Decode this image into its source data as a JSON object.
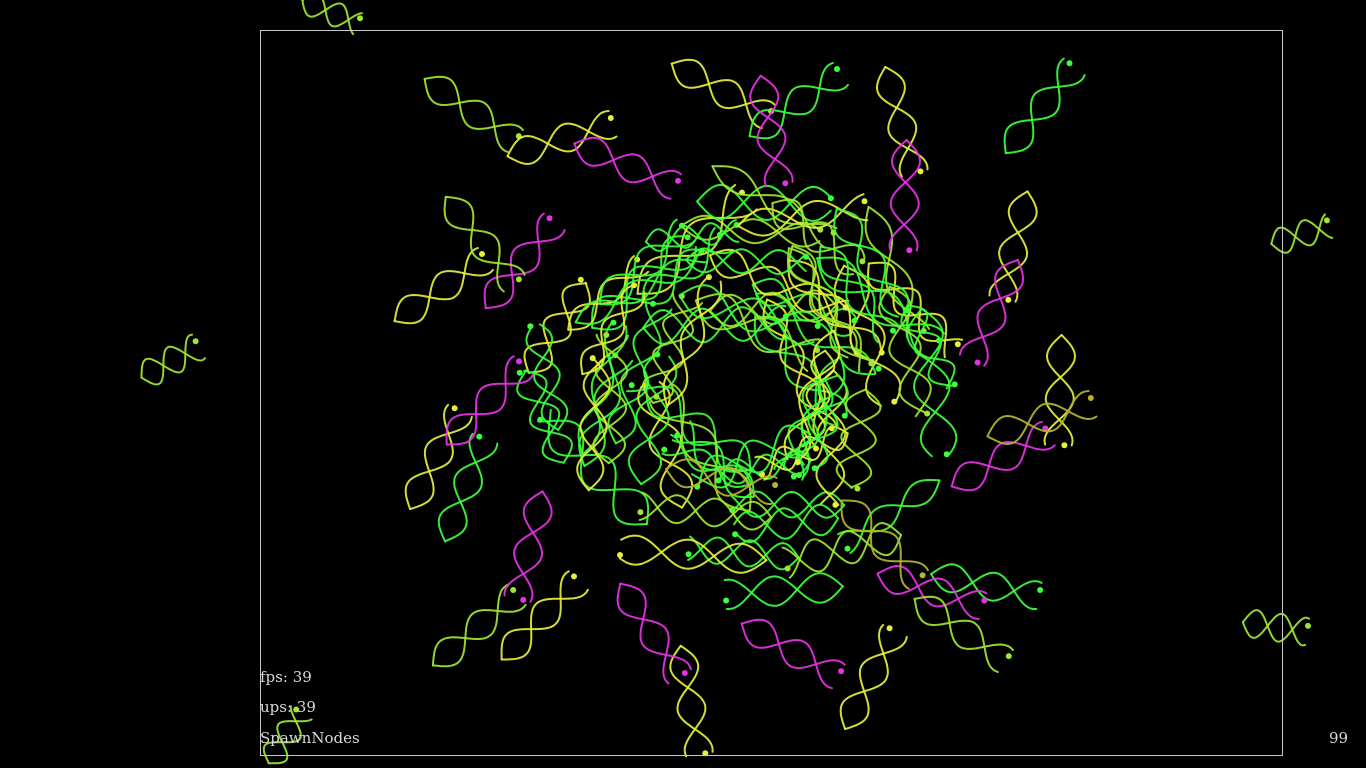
{
  "hud": {
    "fps_label": "fps:",
    "fps_value": "39",
    "ups_label": "ups:",
    "ups_value": "39",
    "mode": "SpawnNodes",
    "node_count": "99"
  },
  "colors": {
    "background": "#000000",
    "frame": "#c8c8c8",
    "green": "#3cff3c",
    "yellow": "#e6f03c",
    "lime": "#a0e632",
    "magenta": "#e632e6",
    "olive": "#b4b432"
  }
}
